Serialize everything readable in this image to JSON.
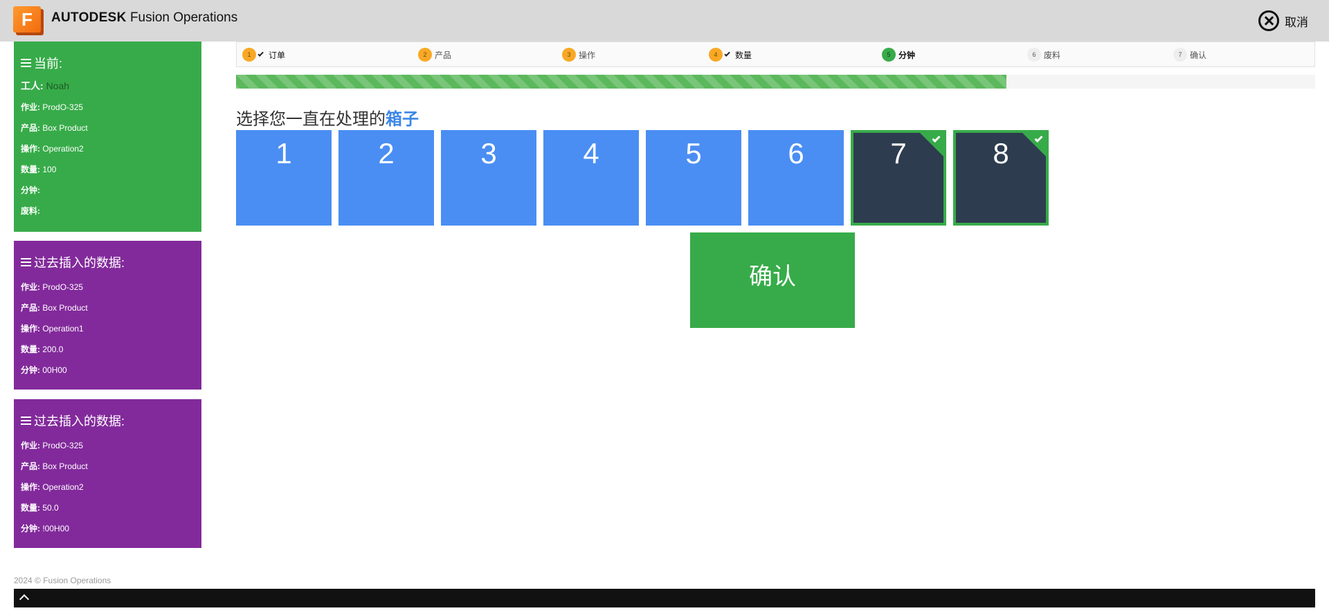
{
  "header": {
    "logo_letter": "F",
    "brand_bold": "AUTODESK",
    "brand_rest": "Fusion Operations",
    "cancel_label": "取消"
  },
  "current_panel": {
    "title": "当前:",
    "worker_label": "工人:",
    "worker_value": "Noah",
    "rows": [
      {
        "key": "作业:",
        "value": "ProdO-325"
      },
      {
        "key": "产品:",
        "value": "Box Product"
      },
      {
        "key": "操作:",
        "value": "Operation2"
      },
      {
        "key": "数量:",
        "value": "100"
      },
      {
        "key": "分钟:",
        "value": ""
      },
      {
        "key": "废料:",
        "value": ""
      }
    ]
  },
  "past_panels": [
    {
      "title": "过去插入的数据:",
      "rows": [
        {
          "key": "作业:",
          "value": "ProdO-325"
        },
        {
          "key": "产品:",
          "value": "Box Product"
        },
        {
          "key": "操作:",
          "value": "Operation1"
        },
        {
          "key": "数量:",
          "value": " 200.0"
        },
        {
          "key": "分钟:",
          "value": "00H00"
        }
      ]
    },
    {
      "title": "过去插入的数据:",
      "rows": [
        {
          "key": "作业:",
          "value": "ProdO-325"
        },
        {
          "key": "产品:",
          "value": "Box Product"
        },
        {
          "key": "操作:",
          "value": "Operation2"
        },
        {
          "key": "数量:",
          "value": "50.0"
        },
        {
          "key": "分钟:",
          "value": "!00H00"
        }
      ]
    }
  ],
  "steps": [
    {
      "num": "1",
      "label": "订单",
      "state": "done"
    },
    {
      "num": "2",
      "label": "产品",
      "state": "pending-orange"
    },
    {
      "num": "3",
      "label": "操作",
      "state": "pending-orange"
    },
    {
      "num": "4",
      "label": "数量",
      "state": "done"
    },
    {
      "num": "5",
      "label": "分钟",
      "state": "active"
    },
    {
      "num": "6",
      "label": "废料",
      "state": "pending"
    },
    {
      "num": "7",
      "label": "确认",
      "state": "pending"
    }
  ],
  "progress_fraction": 0.714,
  "prompt": {
    "text": "选择您一直在处理的",
    "highlight": "箱子"
  },
  "boxes": [
    {
      "label": "1",
      "selected": false
    },
    {
      "label": "2",
      "selected": false
    },
    {
      "label": "3",
      "selected": false
    },
    {
      "label": "4",
      "selected": false
    },
    {
      "label": "5",
      "selected": false
    },
    {
      "label": "6",
      "selected": false
    },
    {
      "label": "7",
      "selected": true
    },
    {
      "label": "8",
      "selected": true
    }
  ],
  "confirm_label": "确认",
  "footer": {
    "copyright": "2024 © Fusion Operations"
  },
  "colors": {
    "green": "#37ab49",
    "purple": "#822a9b",
    "blue": "#4a8ef3",
    "dark_box": "#2d3c4f",
    "orange": "#f9a825"
  }
}
